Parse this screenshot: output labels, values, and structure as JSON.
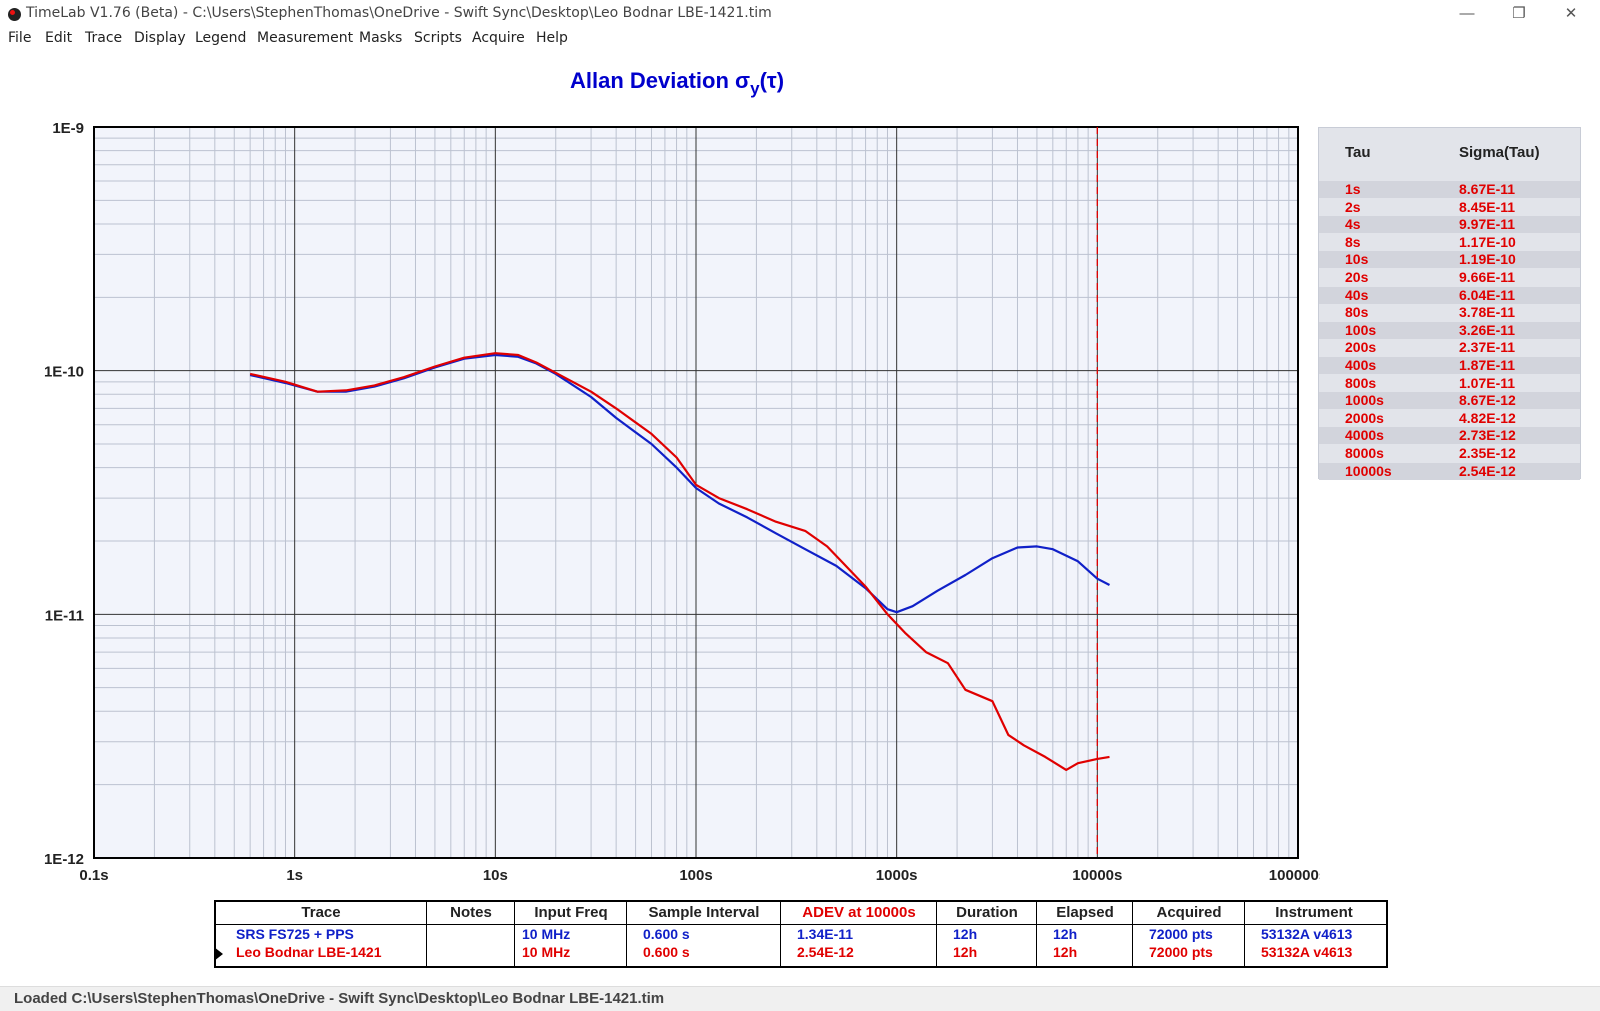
{
  "window": {
    "title": "TimeLab V1.76 (Beta) - C:\\Users\\StephenThomas\\OneDrive - Swift Sync\\Desktop\\Leo Bodnar LBE-1421.tim",
    "minimize": "—",
    "maximize": "❐",
    "close": "✕"
  },
  "menu": [
    "File",
    "Edit",
    "Trace",
    "Display",
    "Legend",
    "Measurement",
    "Masks",
    "Scripts",
    "Acquire",
    "Help"
  ],
  "chart_data": {
    "type": "line",
    "title": "Allan Deviation σ",
    "title_sub": "y",
    "title_suffix": "(τ)",
    "xscale": "log",
    "yscale": "log",
    "xlim": [
      0.1,
      100000
    ],
    "ylim": [
      1e-12,
      1e-09
    ],
    "x_tick_labels": [
      "0.1s",
      "1s",
      "10s",
      "100s",
      "1000s",
      "10000s",
      "100000s"
    ],
    "y_tick_labels": [
      "1E-9",
      "1E-10",
      "1E-11",
      "1E-12"
    ],
    "grid": true,
    "marker_x": 10000,
    "series": [
      {
        "name": "SRS FS725 + PPS",
        "color": "#1020c8",
        "points": [
          [
            0.6,
            9.6e-11
          ],
          [
            0.9,
            8.9e-11
          ],
          [
            1.3,
            8.2e-11
          ],
          [
            1.8,
            8.2e-11
          ],
          [
            2.5,
            8.6e-11
          ],
          [
            3.5,
            9.3e-11
          ],
          [
            5,
            1.03e-10
          ],
          [
            7,
            1.12e-10
          ],
          [
            10,
            1.16e-10
          ],
          [
            13,
            1.14e-10
          ],
          [
            16,
            1.07e-10
          ],
          [
            20,
            9.7e-11
          ],
          [
            30,
            7.8e-11
          ],
          [
            40,
            6.4e-11
          ],
          [
            60,
            5e-11
          ],
          [
            80,
            4e-11
          ],
          [
            100,
            3.3e-11
          ],
          [
            130,
            2.85e-11
          ],
          [
            180,
            2.5e-11
          ],
          [
            250,
            2.15e-11
          ],
          [
            350,
            1.85e-11
          ],
          [
            500,
            1.58e-11
          ],
          [
            700,
            1.28e-11
          ],
          [
            900,
            1.05e-11
          ],
          [
            1000,
            1.02e-11
          ],
          [
            1200,
            1.08e-11
          ],
          [
            1600,
            1.25e-11
          ],
          [
            2200,
            1.45e-11
          ],
          [
            3000,
            1.7e-11
          ],
          [
            4000,
            1.88e-11
          ],
          [
            5000,
            1.9e-11
          ],
          [
            6000,
            1.85e-11
          ],
          [
            8000,
            1.65e-11
          ],
          [
            10000,
            1.4e-11
          ],
          [
            11500,
            1.32e-11
          ]
        ]
      },
      {
        "name": "Leo Bodnar LBE-1421",
        "color": "#e00000",
        "points": [
          [
            0.6,
            9.7e-11
          ],
          [
            0.9,
            9e-11
          ],
          [
            1.3,
            8.2e-11
          ],
          [
            1.8,
            8.3e-11
          ],
          [
            2.5,
            8.7e-11
          ],
          [
            3.5,
            9.4e-11
          ],
          [
            5,
            1.04e-10
          ],
          [
            7,
            1.13e-10
          ],
          [
            10,
            1.18e-10
          ],
          [
            13,
            1.16e-10
          ],
          [
            16,
            1.08e-10
          ],
          [
            20,
            9.8e-11
          ],
          [
            30,
            8.2e-11
          ],
          [
            40,
            7e-11
          ],
          [
            60,
            5.5e-11
          ],
          [
            80,
            4.4e-11
          ],
          [
            100,
            3.4e-11
          ],
          [
            130,
            3e-11
          ],
          [
            180,
            2.7e-11
          ],
          [
            250,
            2.4e-11
          ],
          [
            350,
            2.2e-11
          ],
          [
            450,
            1.9e-11
          ],
          [
            550,
            1.6e-11
          ],
          [
            700,
            1.3e-11
          ],
          [
            900,
            1e-11
          ],
          [
            1100,
            8.4e-12
          ],
          [
            1400,
            7e-12
          ],
          [
            1800,
            6.3e-12
          ],
          [
            2200,
            4.9e-12
          ],
          [
            3000,
            4.4e-12
          ],
          [
            3600,
            3.2e-12
          ],
          [
            4300,
            2.9e-12
          ],
          [
            5500,
            2.6e-12
          ],
          [
            7000,
            2.3e-12
          ],
          [
            8000,
            2.45e-12
          ],
          [
            10000,
            2.55e-12
          ],
          [
            11500,
            2.6e-12
          ]
        ]
      }
    ]
  },
  "tau_table": {
    "col_tau": "Tau",
    "col_sigma": "Sigma(Tau)",
    "rows": [
      {
        "tau": "1s",
        "sigma": "8.67E-11"
      },
      {
        "tau": "2s",
        "sigma": "8.45E-11"
      },
      {
        "tau": "4s",
        "sigma": "9.97E-11"
      },
      {
        "tau": "8s",
        "sigma": "1.17E-10"
      },
      {
        "tau": "10s",
        "sigma": "1.19E-10"
      },
      {
        "tau": "20s",
        "sigma": "9.66E-11"
      },
      {
        "tau": "40s",
        "sigma": "6.04E-11"
      },
      {
        "tau": "80s",
        "sigma": "3.78E-11"
      },
      {
        "tau": "100s",
        "sigma": "3.26E-11"
      },
      {
        "tau": "200s",
        "sigma": "2.37E-11"
      },
      {
        "tau": "400s",
        "sigma": "1.87E-11"
      },
      {
        "tau": "800s",
        "sigma": "1.07E-11"
      },
      {
        "tau": "1000s",
        "sigma": "8.67E-12"
      },
      {
        "tau": "2000s",
        "sigma": "4.82E-12"
      },
      {
        "tau": "4000s",
        "sigma": "2.73E-12"
      },
      {
        "tau": "8000s",
        "sigma": "2.35E-12"
      },
      {
        "tau": "10000s",
        "sigma": "2.54E-12"
      }
    ]
  },
  "legend": {
    "headers": {
      "trace": "Trace",
      "notes": "Notes",
      "input_freq": "Input Freq",
      "sample_interval": "Sample Interval",
      "adev": "ADEV at 10000s",
      "duration": "Duration",
      "elapsed": "Elapsed",
      "acquired": "Acquired",
      "instrument": "Instrument"
    },
    "rows": [
      {
        "trace": "SRS FS725 + PPS",
        "notes": "",
        "input_freq": "10 MHz",
        "sample_interval": "0.600 s",
        "adev": "1.34E-11",
        "duration": "12h",
        "elapsed": "12h",
        "acquired": "72000 pts",
        "instrument": "53132A v4613"
      },
      {
        "trace": "Leo Bodnar LBE-1421",
        "notes": "",
        "input_freq": "10 MHz",
        "sample_interval": "0.600 s",
        "adev": "2.54E-12",
        "duration": "12h",
        "elapsed": "12h",
        "acquired": "72000 pts",
        "instrument": "53132A v4613"
      }
    ]
  },
  "status": "Loaded  C:\\Users\\StephenThomas\\OneDrive  -  Swift  Sync\\Desktop\\Leo  Bodnar  LBE-1421.tim"
}
